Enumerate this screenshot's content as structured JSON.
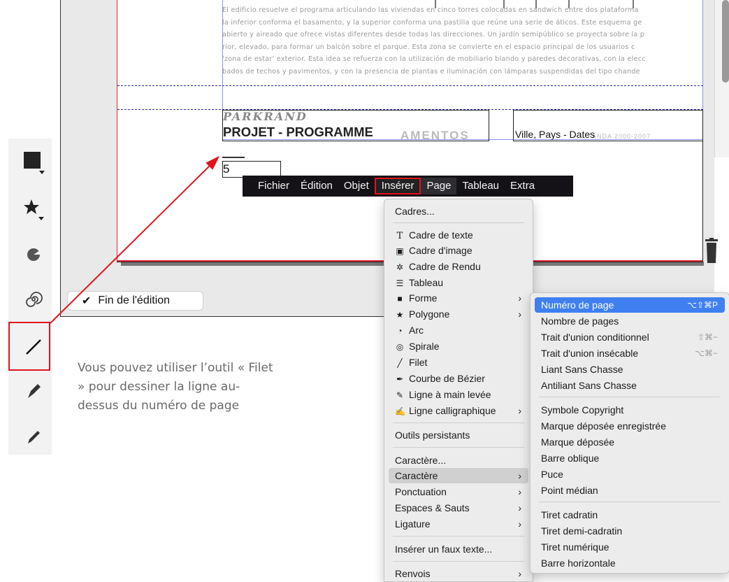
{
  "document": {
    "body_lines": [
      "El edificio resuelve el programa articulando las viviendas en cinco torres colocadas en sandwich entre dos plataforma",
      "la inferior conforma el basamento, y la superior conforma una pastilla que reúne una serie de áticos. Este esquema ge",
      "abierto y aireado que ofrece vistas diferentes desde todas las direcciones. Un jardín semipúblico se proyecta sobre la p",
      "rior, elevado, para formar un balcón sobre el parque. Esta zona se convierte en el espacio principal de los usuarios c",
      "'zona de estar' exterior. Esta idea se refuerza con la utilización de mobiliario blando y paredes decorativas, con la elecc",
      "bados de techos y pavimentos, y con la presencia de plantas e iluminación con lámparas suspendidas del tipo chande"
    ],
    "header_brand": "PARKRAND",
    "header_title": "PROJET - PROGRAMME",
    "header_ghost": "AMENTOS",
    "header_right": "Ville, Pays - Dates",
    "header_right_ghost": "ANDA   2000-2007",
    "page_number": "5"
  },
  "toolbar": {
    "tools": [
      "rectangle-tool",
      "polygon-tool",
      "arc-tool",
      "spiral-tool",
      "line-tool",
      "bezier-tool",
      "freehand-tool"
    ],
    "selected": "line-tool"
  },
  "fin_edition": {
    "check": "✔",
    "label": "Fin de l'édition"
  },
  "tip": "Vous pouvez utiliser l’outil « Filet » pour dessiner la ligne au-dessus du numéro de page",
  "menubar": {
    "items": [
      "Fichier",
      "Édition",
      "Objet",
      "Insérer",
      "Page",
      "Tableau",
      "Extra"
    ],
    "active": "Insérer"
  },
  "insert_menu": {
    "items": [
      {
        "label": "Cadres...",
        "icon": "",
        "submenu": false
      },
      {
        "label": "Cadre de texte",
        "icon": "text-frame-icon",
        "submenu": false
      },
      {
        "label": "Cadre d'image",
        "icon": "image-frame-icon",
        "submenu": false
      },
      {
        "label": "Cadre de Rendu",
        "icon": "render-frame-icon",
        "submenu": false
      },
      {
        "label": "Tableau",
        "icon": "table-icon",
        "submenu": false
      },
      {
        "label": "Forme",
        "icon": "shape-icon",
        "submenu": true
      },
      {
        "label": "Polygone",
        "icon": "star-icon",
        "submenu": true
      },
      {
        "label": "Arc",
        "icon": "arc-icon",
        "submenu": false
      },
      {
        "label": "Spirale",
        "icon": "spiral-icon",
        "submenu": false
      },
      {
        "label": "Filet",
        "icon": "line-icon",
        "submenu": false
      },
      {
        "label": "Courbe de Bézier",
        "icon": "bezier-icon",
        "submenu": false
      },
      {
        "label": "Ligne à main levée",
        "icon": "freehand-icon",
        "submenu": false
      },
      {
        "label": "Ligne calligraphique",
        "icon": "calligraphic-icon",
        "submenu": true
      },
      {
        "label": "Outils persistants",
        "icon": "",
        "submenu": false
      },
      {
        "label": "Caractère...",
        "icon": "",
        "submenu": false
      },
      {
        "label": "Caractère",
        "icon": "",
        "submenu": true,
        "selected": true
      },
      {
        "label": "Ponctuation",
        "icon": "",
        "submenu": true
      },
      {
        "label": "Espaces & Sauts",
        "icon": "",
        "submenu": true
      },
      {
        "label": "Ligature",
        "icon": "",
        "submenu": true
      },
      {
        "label": "Insérer un faux texte...",
        "icon": "",
        "submenu": false
      },
      {
        "label": "Renvois",
        "icon": "",
        "submenu": true
      }
    ]
  },
  "char_menu": {
    "items": [
      {
        "label": "Numéro de page",
        "shortcut": "⌥⇧⌘P",
        "highlighted": true
      },
      {
        "label": "Nombre de pages",
        "shortcut": ""
      },
      {
        "label": "Trait d'union conditionnel",
        "shortcut": "⇧⌘−"
      },
      {
        "label": "Trait d'union insécable",
        "shortcut": "⌥⌘−"
      },
      {
        "label": "Liant Sans Chasse",
        "shortcut": ""
      },
      {
        "label": "Antiliant Sans Chasse",
        "shortcut": ""
      },
      {
        "label": "Symbole Copyright",
        "shortcut": ""
      },
      {
        "label": "Marque déposée enregistrée",
        "shortcut": ""
      },
      {
        "label": "Marque déposée",
        "shortcut": ""
      },
      {
        "label": "Barre oblique",
        "shortcut": ""
      },
      {
        "label": "Puce",
        "shortcut": ""
      },
      {
        "label": "Point médian",
        "shortcut": ""
      },
      {
        "label": "Tiret cadratin",
        "shortcut": ""
      },
      {
        "label": "Tiret demi-cadratin",
        "shortcut": ""
      },
      {
        "label": "Tiret numérique",
        "shortcut": ""
      },
      {
        "label": "Barre horizontale",
        "shortcut": ""
      }
    ]
  },
  "colors": {
    "annotation_red": "#e0141e",
    "menu_highlight": "#3f7ff2",
    "menubar_bg": "#141216"
  }
}
